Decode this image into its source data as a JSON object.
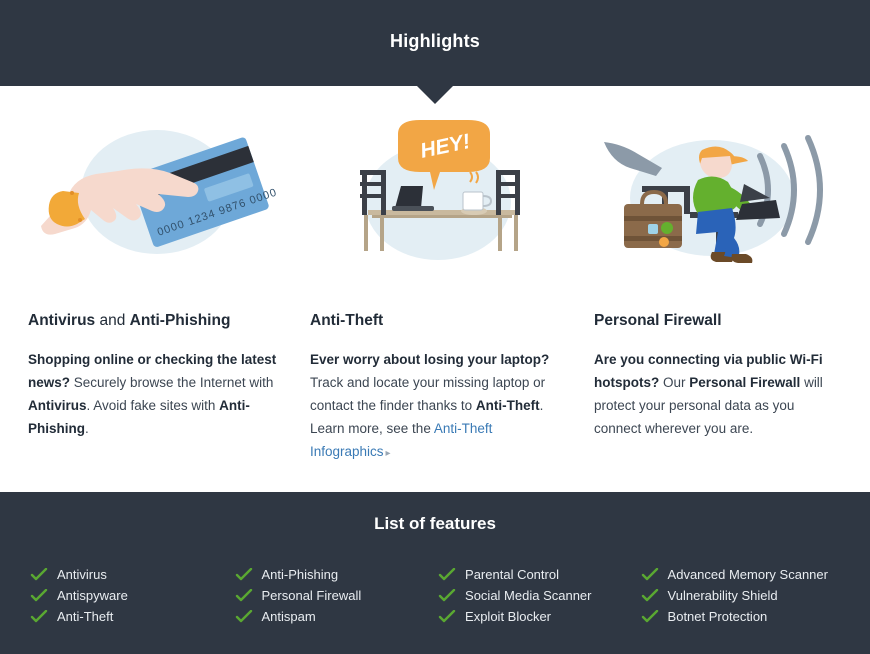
{
  "header": {
    "title": "Highlights",
    "background_color": "#2f3743"
  },
  "columns": [
    {
      "illustration": "hand-holding-credit-card-illustration",
      "card_number": "0000 1234 9876 0000",
      "heading_parts": [
        {
          "text": "Antivirus",
          "bold": true
        },
        {
          "text": " and ",
          "bold": false
        },
        {
          "text": "Anti-Phishing",
          "bold": true
        }
      ],
      "body_parts": [
        {
          "text": "Shopping online or checking the latest news?",
          "bold": true
        },
        {
          "text": " Securely browse the Internet with ",
          "bold": false
        },
        {
          "text": "Antivirus",
          "bold": true
        },
        {
          "text": ". Avoid fake sites with ",
          "bold": false
        },
        {
          "text": "Anti-Phishing",
          "bold": true
        },
        {
          "text": ".",
          "bold": false
        }
      ]
    },
    {
      "illustration": "cafe-table-laptop-speech-bubble-illustration",
      "bubble_text": "HEY!",
      "heading_parts": [
        {
          "text": "Anti-Theft",
          "bold": true
        }
      ],
      "body_parts": [
        {
          "text": "Ever worry about losing your laptop?",
          "bold": true
        },
        {
          "text": " Track and locate your missing laptop or contact the finder thanks to ",
          "bold": false
        },
        {
          "text": "Anti-Theft",
          "bold": true
        },
        {
          "text": ". Learn more, see the ",
          "bold": false
        }
      ],
      "link_text": "Anti-Theft Infographics",
      "link_arrow": "▸"
    },
    {
      "illustration": "traveler-with-laptop-wifi-illustration",
      "heading_parts": [
        {
          "text": "Personal Firewall",
          "bold": true
        }
      ],
      "body_parts": [
        {
          "text": "Are you connecting via public Wi-Fi hotspots?",
          "bold": true
        },
        {
          "text": " Our ",
          "bold": false
        },
        {
          "text": "Personal Firewall",
          "bold": true
        },
        {
          "text": " will protect your personal data as you connect wherever you are.",
          "bold": false
        }
      ]
    }
  ],
  "footer": {
    "title": "List of features",
    "background_color": "#2f3743",
    "check_color": "#5aa832",
    "feature_columns": [
      [
        "Antivirus",
        "Antispyware",
        "Anti-Theft"
      ],
      [
        "Anti-Phishing",
        "Personal Firewall",
        "Antispam"
      ],
      [
        "Parental Control",
        "Social Media Scanner",
        "Exploit Blocker"
      ],
      [
        "Advanced Memory Scanner",
        "Vulnerability Shield",
        "Botnet Protection"
      ]
    ]
  }
}
